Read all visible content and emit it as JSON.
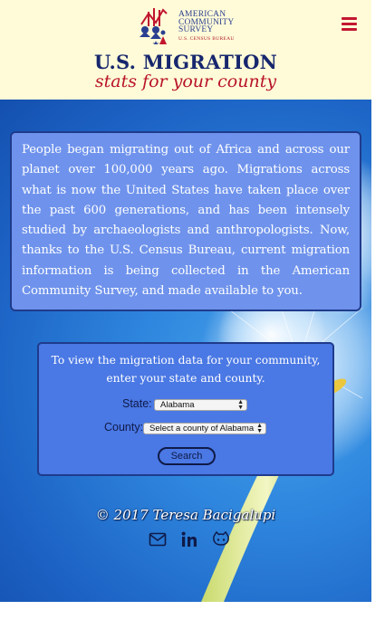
{
  "header": {
    "logo": {
      "line1": "AMERICAN",
      "line2": "COMMUNITY",
      "line3": "SURVEY",
      "sub": "U.S. CENSUS BUREAU"
    },
    "menu_icon": "hamburger-menu-icon",
    "title": "U.S. MIGRATION",
    "subtitle": "stats for your county",
    "colors": {
      "background": "#fffbd8",
      "title": "#17276e",
      "accent": "#b8142a"
    }
  },
  "intro": {
    "text": "People began migrating out of Africa and across our planet over 100,000 years ago. Migrations across what is now the United States have taken place over the past 600 generations, and has been intensely studied by archaeologists and anthropologists. Now, thanks to the U.S. Census Bureau, current migration information is being collected in the American Community Survey, and made available to you."
  },
  "form": {
    "prompt_line1": "To view the migration data for your community,",
    "prompt_line2": "enter your state and county.",
    "state_label": "State:",
    "state_value": "Alabama",
    "county_label": "County:",
    "county_value": "Select a county of Alabama",
    "search_label": "Search"
  },
  "footer": {
    "copyright": "© 2017 Teresa Bacigalupi",
    "social": [
      "email-icon",
      "linkedin-icon",
      "github-icon"
    ]
  }
}
